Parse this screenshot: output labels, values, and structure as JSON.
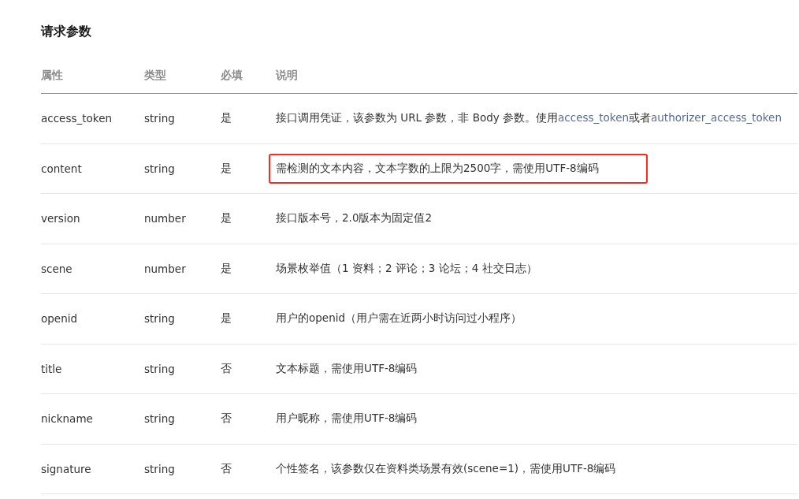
{
  "section_title": "请求参数",
  "table": {
    "columns": [
      "属性",
      "类型",
      "必填",
      "说明"
    ],
    "rows": [
      {
        "name": "access_token",
        "type": "string",
        "required": "是",
        "highlighted": false,
        "description": [
          {
            "kind": "text",
            "text": "接口调用凭证，该参数为 URL 参数，非 Body 参数。使用"
          },
          {
            "kind": "link",
            "text": "access_token"
          },
          {
            "kind": "text",
            "text": "或者"
          },
          {
            "kind": "link",
            "text": "authorizer_access_token"
          }
        ]
      },
      {
        "name": "content",
        "type": "string",
        "required": "是",
        "highlighted": true,
        "description": [
          {
            "kind": "text",
            "text": "需检测的文本内容，文本字数的上限为2500字，需使用UTF-8编码"
          }
        ]
      },
      {
        "name": "version",
        "type": "number",
        "required": "是",
        "highlighted": false,
        "description": [
          {
            "kind": "text",
            "text": "接口版本号，2.0版本为固定值2"
          }
        ]
      },
      {
        "name": "scene",
        "type": "number",
        "required": "是",
        "highlighted": false,
        "description": [
          {
            "kind": "text",
            "text": "场景枚举值（1 资料；2 评论；3 论坛；4 社交日志）"
          }
        ]
      },
      {
        "name": "openid",
        "type": "string",
        "required": "是",
        "highlighted": false,
        "description": [
          {
            "kind": "text",
            "text": "用户的openid（用户需在近两小时访问过小程序）"
          }
        ]
      },
      {
        "name": "title",
        "type": "string",
        "required": "否",
        "highlighted": false,
        "description": [
          {
            "kind": "text",
            "text": "文本标题，需使用UTF-8编码"
          }
        ]
      },
      {
        "name": "nickname",
        "type": "string",
        "required": "否",
        "highlighted": false,
        "description": [
          {
            "kind": "text",
            "text": "用户昵称，需使用UTF-8编码"
          }
        ]
      },
      {
        "name": "signature",
        "type": "string",
        "required": "否",
        "highlighted": false,
        "description": [
          {
            "kind": "text",
            "text": "个性签名，该参数仅在资料类场景有效(scene=1)，需使用UTF-8编码"
          }
        ]
      }
    ]
  }
}
